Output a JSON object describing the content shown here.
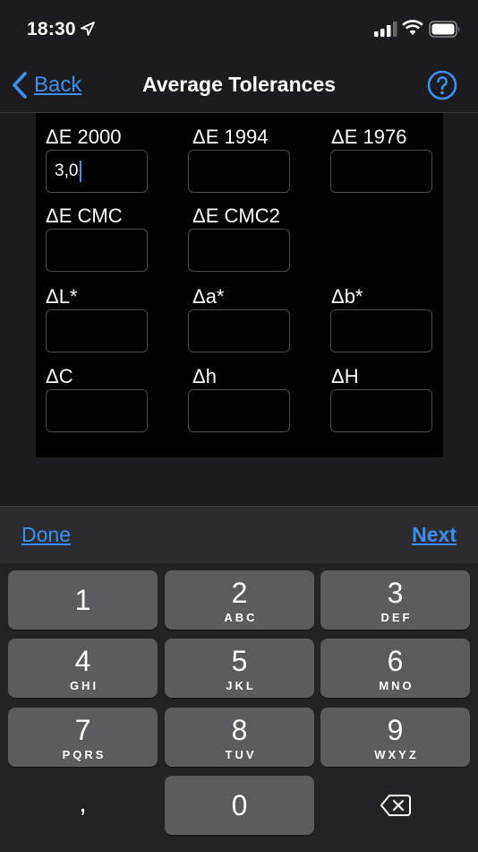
{
  "status": {
    "time": "18:30"
  },
  "nav": {
    "back_label": "Back",
    "title": "Average Tolerances",
    "help_icon": "question-circle-icon"
  },
  "fields": {
    "de2000": {
      "label": "ΔE 2000",
      "value": "3,0"
    },
    "de1994": {
      "label": "ΔE 1994",
      "value": ""
    },
    "de1976": {
      "label": "ΔE 1976",
      "value": ""
    },
    "decmc": {
      "label": "ΔE CMC",
      "value": ""
    },
    "decmc2": {
      "label": "ΔE CMC2",
      "value": ""
    },
    "dl": {
      "label": "ΔL*",
      "value": ""
    },
    "da": {
      "label": "Δa*",
      "value": ""
    },
    "db": {
      "label": "Δb*",
      "value": ""
    },
    "dc": {
      "label": "ΔC",
      "value": ""
    },
    "dh_lower": {
      "label": "Δh",
      "value": ""
    },
    "dh_upper": {
      "label": "ΔH",
      "value": ""
    }
  },
  "accessory": {
    "done_label": "Done",
    "next_label": "Next"
  },
  "keypad": {
    "keys": [
      {
        "digit": "1",
        "letters": ""
      },
      {
        "digit": "2",
        "letters": "ABC"
      },
      {
        "digit": "3",
        "letters": "DEF"
      },
      {
        "digit": "4",
        "letters": "GHI"
      },
      {
        "digit": "5",
        "letters": "JKL"
      },
      {
        "digit": "6",
        "letters": "MNO"
      },
      {
        "digit": "7",
        "letters": "PQRS"
      },
      {
        "digit": "8",
        "letters": "TUV"
      },
      {
        "digit": "9",
        "letters": "WXYZ"
      }
    ],
    "comma": ",",
    "zero": "0",
    "delete_icon": "backspace-icon"
  },
  "colors": {
    "accent": "#3d8ef2",
    "background": "#1c1c1e",
    "panel": "#000000",
    "key": "#5c5c5e"
  }
}
